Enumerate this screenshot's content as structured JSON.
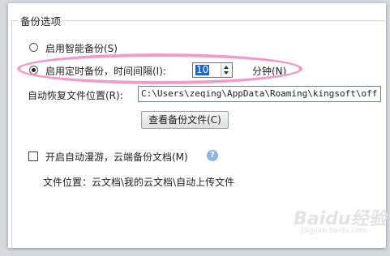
{
  "backup_options": {
    "group_title": "备份选项",
    "smart_backup_label": "启用智能备份(S)",
    "timed_backup_label": "启用定时备份，时间间隔(I):",
    "interval_value": "10",
    "interval_unit": "分钟(N)",
    "restore_location_label": "自动恢复文件位置(R):",
    "restore_location_value": "C:\\Users\\zeqing\\AppData\\Roaming\\kingsoft\\off",
    "view_backup_button": "查看备份文件(C)",
    "roaming_checkbox_label": "开启自动漫游，云端备份文档(M)",
    "file_location_text": "文件位置：云文档\\我的云文档\\自动上传文件"
  },
  "state": {
    "smart_backup_selected": false,
    "timed_backup_selected": true,
    "roaming_checked": false
  },
  "watermark": {
    "text": "Baidu经验",
    "sub": "jingyan.baidu.com"
  },
  "colors": {
    "highlight_ellipse": "#f29bc9",
    "selection": "#1e63d6",
    "help_icon": "#8fb5e3"
  }
}
